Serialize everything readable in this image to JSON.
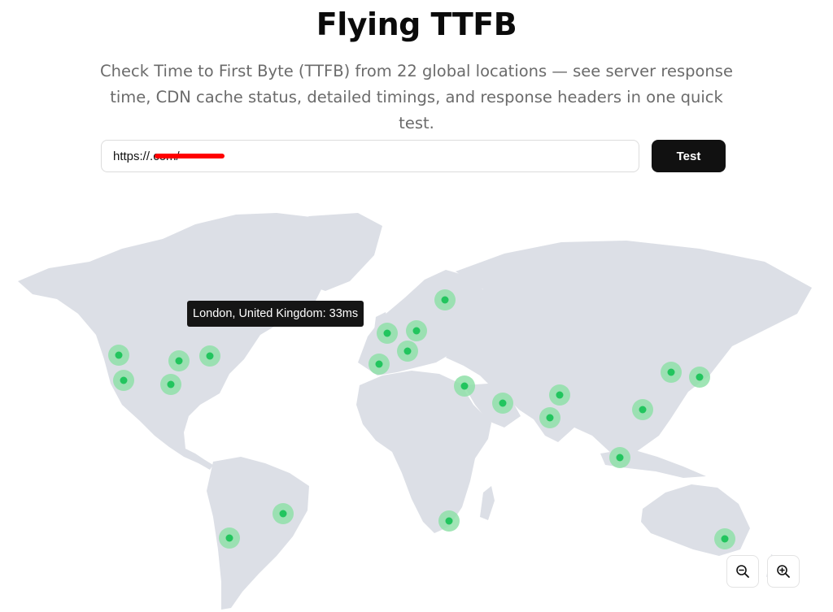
{
  "header": {
    "title": "Flying TTFB",
    "subtitle": "Check Time to First Byte (TTFB) from 22 global locations — see server response time, CDN cache status, detailed timings, and response headers in one quick test."
  },
  "form": {
    "url_value": "https://.com/",
    "test_label": "Test"
  },
  "map": {
    "tooltip": "London, United Kingdom: 33ms",
    "marker_color": "#22c55e",
    "marker_halo_color": "#8fe0a8",
    "land_color": "#dcdfe6",
    "zoom_out_icon": "zoom-out-icon",
    "zoom_in_icon": "zoom-in-icon"
  }
}
